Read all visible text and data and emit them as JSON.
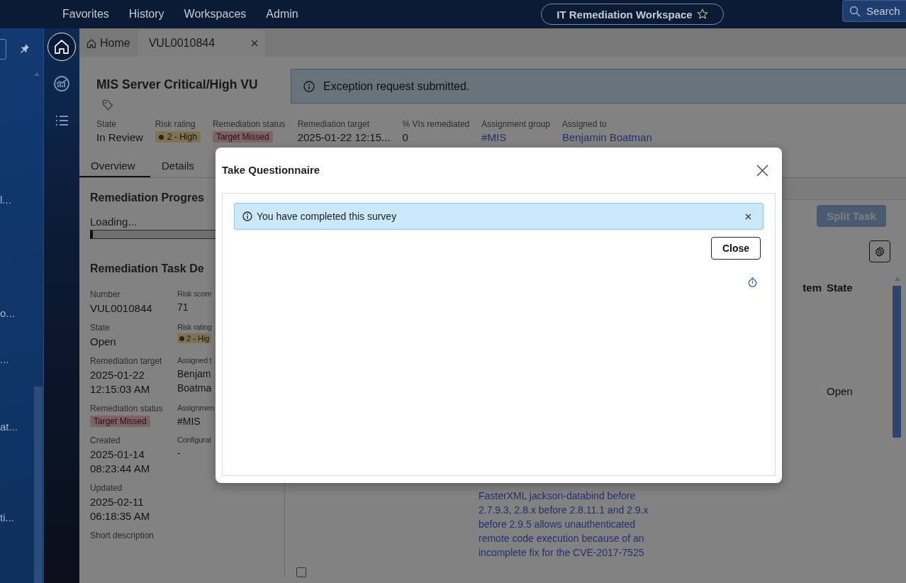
{
  "top_nav": {
    "menu": [
      "Favorites",
      "History",
      "Workspaces",
      "Admin"
    ],
    "workspace": {
      "label": "IT Remediation Workspace",
      "favorite": false
    },
    "search": {
      "label": "Search"
    }
  },
  "side_panel": {
    "items": [
      "l...",
      "o...",
      "...",
      "at...",
      "ti..."
    ]
  },
  "rail": {
    "items": [
      {
        "kind": "home",
        "selected": true
      },
      {
        "kind": "chart",
        "selected": false
      },
      {
        "kind": "list",
        "selected": false
      }
    ]
  },
  "tabs": [
    {
      "label": "Home",
      "kind": "home",
      "selected": false,
      "closable": false
    },
    {
      "label": "VUL0010844",
      "kind": "record",
      "selected": true,
      "closable": true
    }
  ],
  "record": {
    "title": "MIS Server Critical/High VU",
    "fields": [
      {
        "label": "State",
        "value": "In Review",
        "kind": "text"
      },
      {
        "label": "Risk rating",
        "value": "2 - High",
        "kind": "rating"
      },
      {
        "label": "Remediation status",
        "value": "Target Missed",
        "kind": "alert"
      },
      {
        "label": "Remediation target",
        "value": "2025-01-22 12:15...",
        "kind": "text"
      },
      {
        "label": "% VIs remediated",
        "value": "0",
        "kind": "text"
      },
      {
        "label": "Assignment group",
        "value": "#MIS",
        "kind": "link"
      },
      {
        "label": "Assigned to",
        "value": "Benjamin Boatman",
        "kind": "link"
      }
    ],
    "view_tabs": [
      {
        "label": "Overview",
        "selected": true
      },
      {
        "label": "Details",
        "selected": false
      }
    ]
  },
  "toast": {
    "message": "Exception request submitted."
  },
  "progress": {
    "title": "Remediation Progres",
    "status": "Loading...",
    "level": 0.01
  },
  "task_details": {
    "title": "Remediation Task De",
    "rows": [
      [
        {
          "label": "Number",
          "value": "VUL0010844",
          "kind": "text"
        },
        {
          "label": "Risk score",
          "value": "71",
          "kind": "text"
        }
      ],
      [
        {
          "label": "State",
          "value": "Open",
          "kind": "text"
        },
        {
          "label": "Risk rating",
          "value": "2 - Hig",
          "kind": "rating"
        }
      ],
      [
        {
          "label": "Remediation target",
          "value": "2025-01-22 12:15:03 AM",
          "kind": "text"
        },
        {
          "label": "Assigned t",
          "value": "Benjam Boatma",
          "kind": "text"
        }
      ],
      [
        {
          "label": "Remediation status",
          "value": "Target Missed",
          "kind": "alert"
        },
        {
          "label": "Assignmen",
          "value": "#MIS",
          "kind": "text"
        }
      ],
      [
        {
          "label": "Created",
          "value": "2025-01-14 08:23:44 AM",
          "kind": "text"
        },
        {
          "label": "Configurat",
          "value": "-",
          "kind": "text"
        }
      ],
      [
        {
          "label": "Updated",
          "value": "2025-02-11 06:18:35 AM",
          "kind": "text"
        }
      ],
      [
        {
          "label": "Short description",
          "kind": "label"
        }
      ]
    ]
  },
  "related": {
    "split_button": {
      "label": "Split Task",
      "disabled": true
    },
    "columns": [
      "tem",
      "State"
    ],
    "rows": [
      {
        "state": "Open"
      },
      {
        "text": "FasterXML jackson-databind before 2.7.9.3, 2.8.x before 2.8.11.1 and 2.9.x before 2.9.5 allows unauthenticated remote code execution because of an incomplete fix for the CVE-2017-7525",
        "checked": false
      }
    ]
  },
  "modal": {
    "title": "Take Questionnaire",
    "banner": {
      "message": "You have completed this survey"
    },
    "close_button": "Close"
  }
}
